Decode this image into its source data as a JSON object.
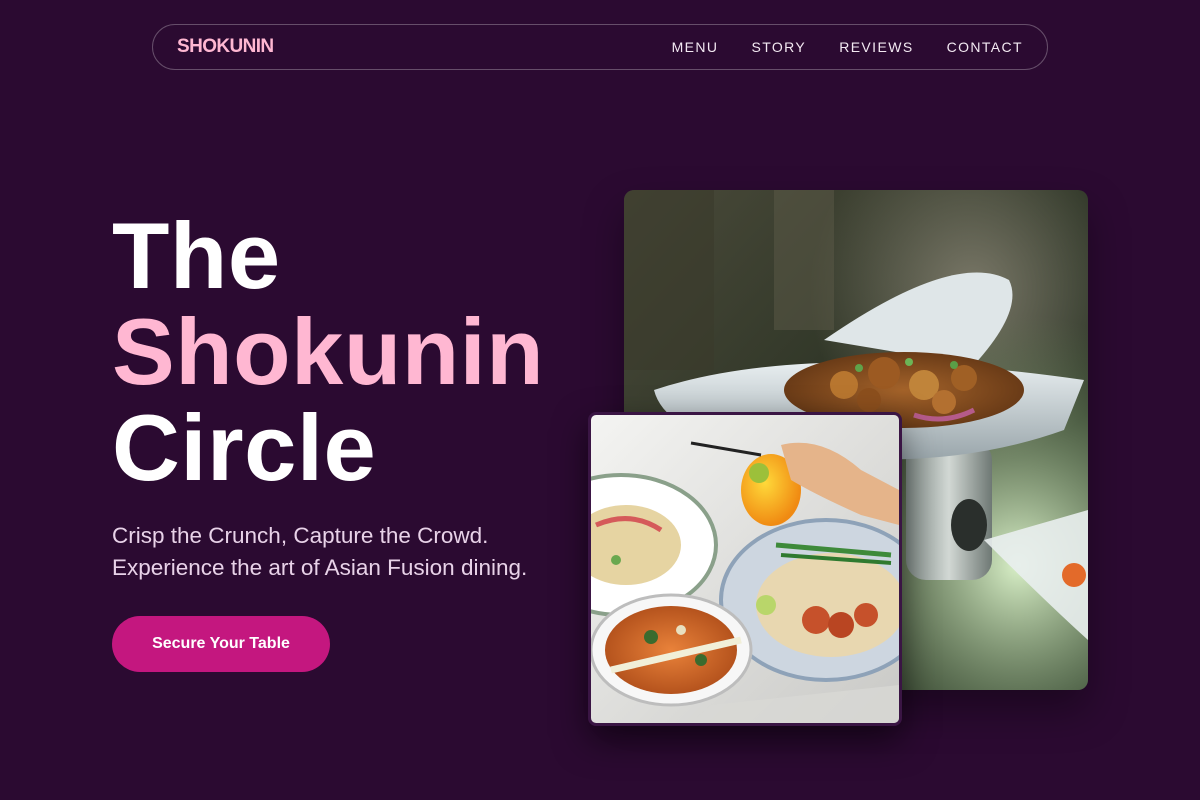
{
  "nav": {
    "brand": "SHOKUNIN",
    "links": [
      {
        "label": "MENU"
      },
      {
        "label": "STORY"
      },
      {
        "label": "REVIEWS"
      },
      {
        "label": "CONTACT"
      }
    ]
  },
  "hero": {
    "title_line1": "The",
    "title_line2": "Shokunin",
    "title_line3": "Circle",
    "tagline_line1": "Crisp the Crunch, Capture the Crowd.",
    "tagline_line2": "Experience the art of Asian Fusion dining.",
    "cta_label": "Secure Your Table"
  },
  "colors": {
    "background": "#2b0a31",
    "accent_pink": "#ffb7d2",
    "cta": "#c4177f",
    "text": "#ffffff"
  },
  "images": {
    "main_photo": "fried-chicken-dish-photo",
    "inset_photo": "thai-food-spread-photo"
  }
}
